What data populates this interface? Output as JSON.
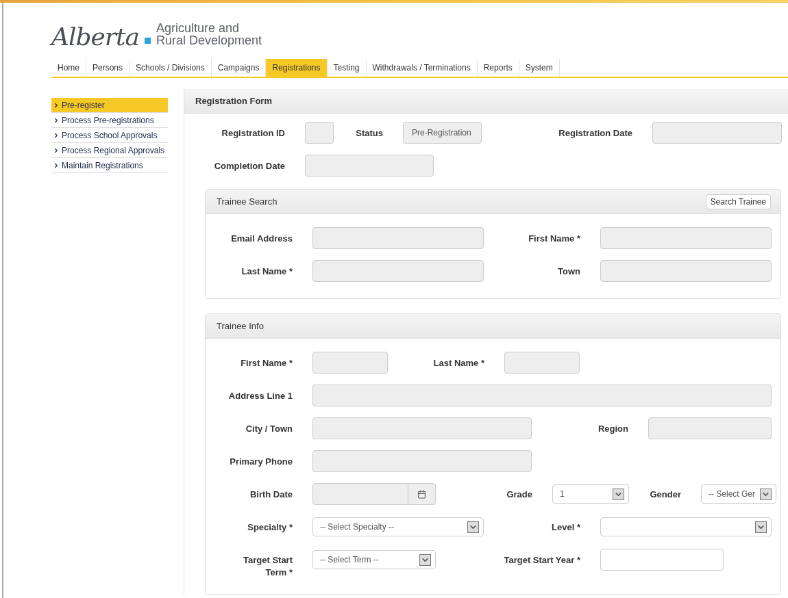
{
  "logo": {
    "wordmark": "Alberta",
    "line_1": "Agriculture and",
    "line_2": "Rural Development"
  },
  "nav": [
    {
      "label": "Home",
      "selected": false
    },
    {
      "label": "Persons",
      "selected": false
    },
    {
      "label": "Schools / Divisions",
      "selected": false
    },
    {
      "label": "Campaigns",
      "selected": false
    },
    {
      "label": "Registrations",
      "selected": true
    },
    {
      "label": "Testing",
      "selected": false
    },
    {
      "label": "Withdrawals / Terminations",
      "selected": false
    },
    {
      "label": "Reports",
      "selected": false
    },
    {
      "label": "System",
      "selected": false
    }
  ],
  "sidebar": {
    "items": [
      {
        "label": "Pre-register",
        "selected": true
      },
      {
        "label": "Process Pre-registrations",
        "selected": false
      },
      {
        "label": "Process School Approvals",
        "selected": false
      },
      {
        "label": "Process Regional Approvals",
        "selected": false
      },
      {
        "label": "Maintain Registrations",
        "selected": false
      }
    ]
  },
  "form": {
    "title": "Registration Form",
    "rows": [
      [
        {
          "label": "Registration ID",
          "kind": "input",
          "disabled": true
        },
        {
          "label": "Status",
          "kind": "input",
          "disabled": true,
          "value": "Pre-Registration"
        },
        {
          "label": "Registration Date",
          "kind": "input",
          "disabled": true
        }
      ],
      [
        {
          "label": "Completion Date",
          "kind": "input",
          "disabled": true
        }
      ]
    ],
    "sections": [
      {
        "title": "Trainee Search",
        "button": "Search Trainee",
        "rows": [
          [
            {
              "label": "Email Address",
              "kind": "input",
              "disabled": true
            },
            {
              "label": "First Name *",
              "kind": "input",
              "disabled": true
            }
          ],
          [
            {
              "label": "Last Name *",
              "kind": "input",
              "disabled": true
            },
            {
              "label": "Town",
              "kind": "input",
              "disabled": true
            }
          ]
        ]
      },
      {
        "title": "Trainee Info",
        "rows": [
          [
            {
              "label": "First Name *",
              "kind": "input",
              "disabled": true
            },
            {
              "label": "Last Name *",
              "kind": "input",
              "disabled": true
            }
          ],
          [
            {
              "label": "Address Line 1",
              "kind": "input",
              "disabled": true
            }
          ],
          [
            {
              "label": "City / Town",
              "kind": "input",
              "disabled": true
            },
            {
              "label": "Region",
              "kind": "input",
              "disabled": true
            }
          ],
          [
            {
              "label": "Primary Phone",
              "kind": "input",
              "disabled": true
            }
          ],
          [
            {
              "label": "Birth Date",
              "kind": "date",
              "disabled": true
            },
            {
              "label": "Grade",
              "kind": "select",
              "disabled": false,
              "value": "1"
            },
            {
              "label": "Gender",
              "kind": "select",
              "disabled": false,
              "value": "-- Select Ger"
            }
          ],
          [
            {
              "label": "Specialty *",
              "kind": "select",
              "disabled": false,
              "value": "-- Select Specialty --"
            },
            {
              "label": "Level *",
              "kind": "select",
              "disabled": false
            }
          ],
          [
            {
              "label": "Target Start Term *",
              "kind": "select",
              "disabled": false,
              "value": "-- Select Term --"
            },
            {
              "label": "Target Start Year *",
              "kind": "input",
              "disabled": false
            }
          ]
        ]
      }
    ]
  }
}
